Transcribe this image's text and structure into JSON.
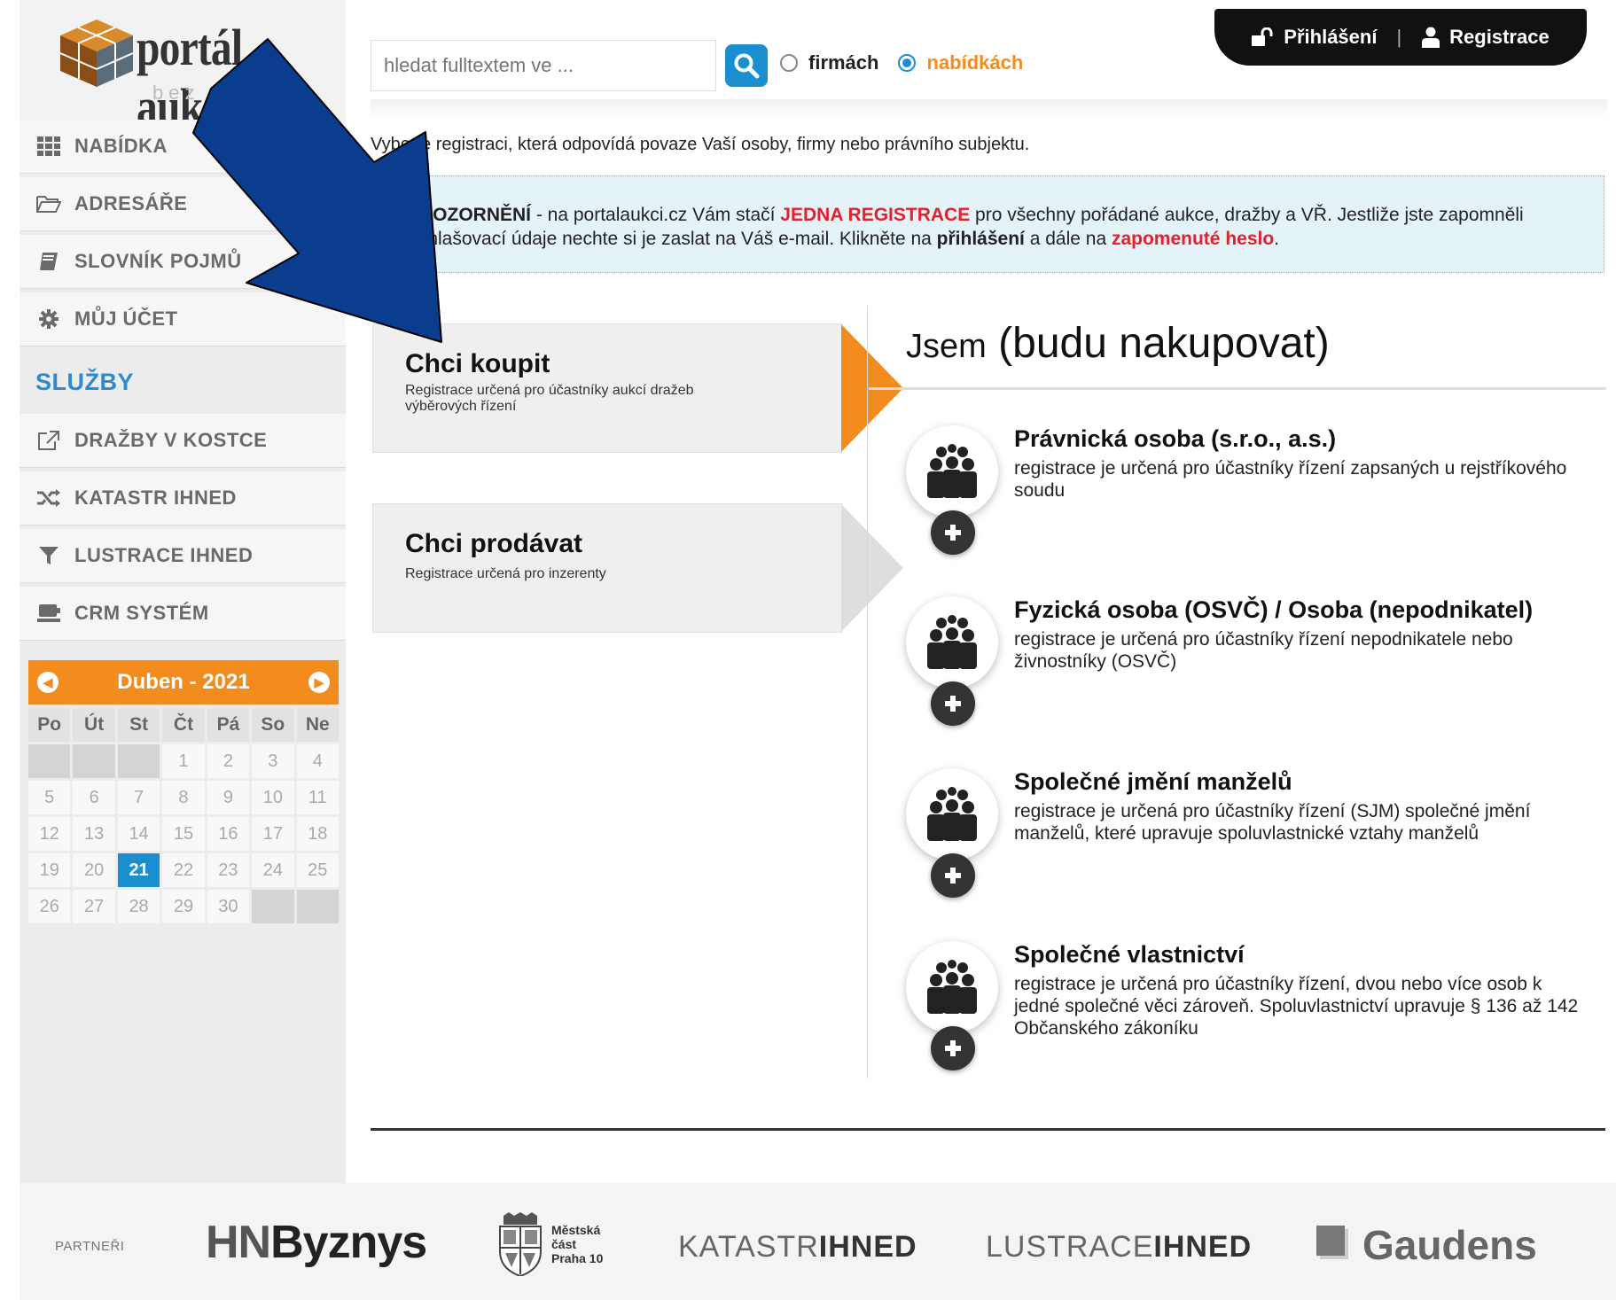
{
  "logo": {
    "text": "portál aukcí",
    "sub": "bez rizik"
  },
  "sidebar": {
    "items": [
      {
        "label": "NABÍDKA",
        "icon": "grid-icon"
      },
      {
        "label": "ADRESÁŘE",
        "icon": "folder-icon"
      },
      {
        "label": "SLOVNÍK POJMŮ",
        "icon": "book-icon"
      },
      {
        "label": "MŮJ ÚČET",
        "icon": "gear-icon"
      }
    ],
    "section_title": "SLUŽBY",
    "services": [
      {
        "label": "DRAŽBY V KOSTCE",
        "icon": "external-link-icon"
      },
      {
        "label": "KATASTR IHNED",
        "icon": "shuffle-icon"
      },
      {
        "label": "LUSTRACE IHNED",
        "icon": "filter-icon"
      },
      {
        "label": "CRM SYSTÉM",
        "icon": "keyboard-icon"
      }
    ]
  },
  "calendar": {
    "month_label": "Duben - 2021",
    "prev_symbol": "◀",
    "next_symbol": "▶",
    "day_names": [
      "Po",
      "Út",
      "St",
      "Čt",
      "Pá",
      "So",
      "Ne"
    ],
    "days": [
      "",
      "",
      "",
      "1",
      "2",
      "3",
      "4",
      "5",
      "6",
      "7",
      "8",
      "9",
      "10",
      "11",
      "12",
      "13",
      "14",
      "15",
      "16",
      "17",
      "18",
      "19",
      "20",
      "21",
      "22",
      "23",
      "24",
      "25",
      "26",
      "27",
      "28",
      "29",
      "30",
      "",
      ""
    ],
    "today": "21"
  },
  "search": {
    "placeholder": "hledat fulltextem ve ...",
    "option_firms": "firmách",
    "option_offers": "nabídkách",
    "selected": "nabídkách"
  },
  "auth": {
    "login": "Přihlášení",
    "separator": "|",
    "register": "Registrace"
  },
  "intro": "Vyberte registraci, která odpovídá povaze Vaší osoby, firmy nebo právního subjektu.",
  "notice": {
    "p1": "UPOZORNĚNÍ",
    "p2": " - na portalaukci.cz Vám stačí ",
    "p3": "JEDNA REGISTRACE",
    "p4": " pro všechny pořádané aukce, dražby a VŘ. Jestliže jste zapomněli přihlašovací údaje nechte si je zaslat na Váš e-mail. Klikněte na ",
    "p5": "přihlášení",
    "p6": " a dále na ",
    "p7": "zapomenuté heslo",
    "p8": "."
  },
  "choices": [
    {
      "title": "Chci koupit",
      "desc": "Registrace určená pro účastníky aukcí dražeb výběrových řízení"
    },
    {
      "title": "Chci prodávat",
      "desc": "Registrace určená pro inzerenty"
    }
  ],
  "jsem": {
    "word": "Jsem",
    "paren": "(budu nakupovat)"
  },
  "options": [
    {
      "title": "Právnická osoba (s.r.o., a.s.)",
      "desc": "registrace je určená pro účastníky řízení zapsaných u rejstříkového soudu"
    },
    {
      "title": "Fyzická osoba (OSVČ) / Osoba (nepodnikatel)",
      "desc": "registrace je určená pro účastníky řízení nepodnikatele nebo živnostníky (OSVČ)"
    },
    {
      "title": "Společné jmění manželů",
      "desc": "registrace je určená pro účastníky řízení (SJM) společné jmění manželů, které upravuje spoluvlastnické vztahy manželů"
    },
    {
      "title": "Společné vlastnictví",
      "desc": "registrace je určená pro účastníky řízení, dvou nebo více osob k jedné společné věci zároveň. Spoluvlastnictví upravuje § 136 až 142 Občanského zákoníku"
    }
  ],
  "footer": {
    "partners_label": "PARTNEŘI",
    "hn_a": "HN",
    "hn_b": "Byznys",
    "praha_l1": "Městská",
    "praha_l2": "část",
    "praha_l3": "Praha 10",
    "katastr_a": "KATASTR",
    "katastr_b": "IHNED",
    "lustrace_a": "LUSTRACE",
    "lustrace_b": "IHNED",
    "gaudens": "Gaudens"
  },
  "colors": {
    "accent_orange": "#f28c1e",
    "accent_blue": "#1a8fd0",
    "overlay_arrow": "#0b3d8f",
    "notice_red": "#e4202a"
  }
}
